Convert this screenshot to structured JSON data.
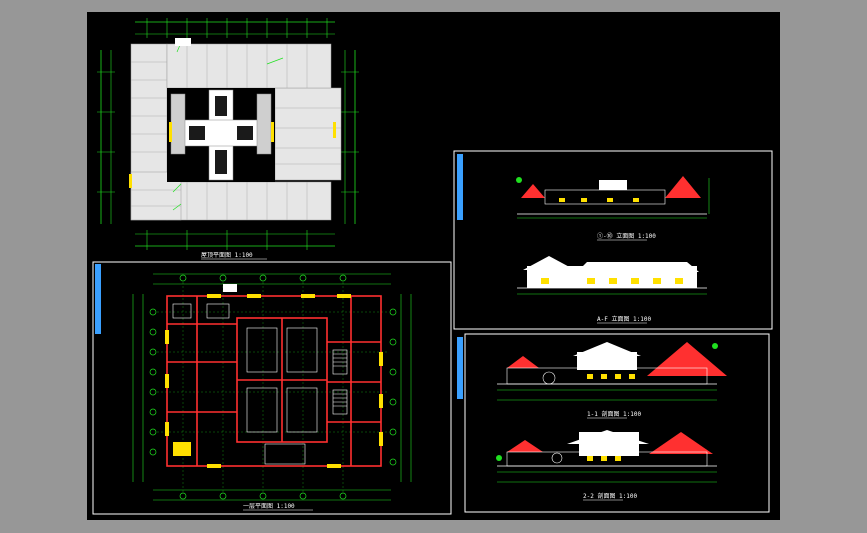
{
  "drawing": {
    "sheet_background": "#000000",
    "viewer_background": "#979797",
    "colors": {
      "border": "#ffffff",
      "dimension": "#20e020",
      "wall": "#ff3030",
      "roof": "#e8e8e8",
      "highlight": "#ffe000",
      "accent_blue": "#3aa0ff"
    },
    "panels": {
      "roof_plan": {
        "caption": "屋顶平面图 1:100"
      },
      "floor_plan": {
        "caption": "一层平面图 1:100"
      },
      "elevation_1": {
        "caption": "①-⑩ 立面图 1:100"
      },
      "elevation_2": {
        "caption": "A-F 立面图 1:100"
      },
      "section_1": {
        "caption": "1-1 剖面图 1:100"
      },
      "section_2": {
        "caption": "2-2 剖面图 1:100"
      }
    }
  }
}
